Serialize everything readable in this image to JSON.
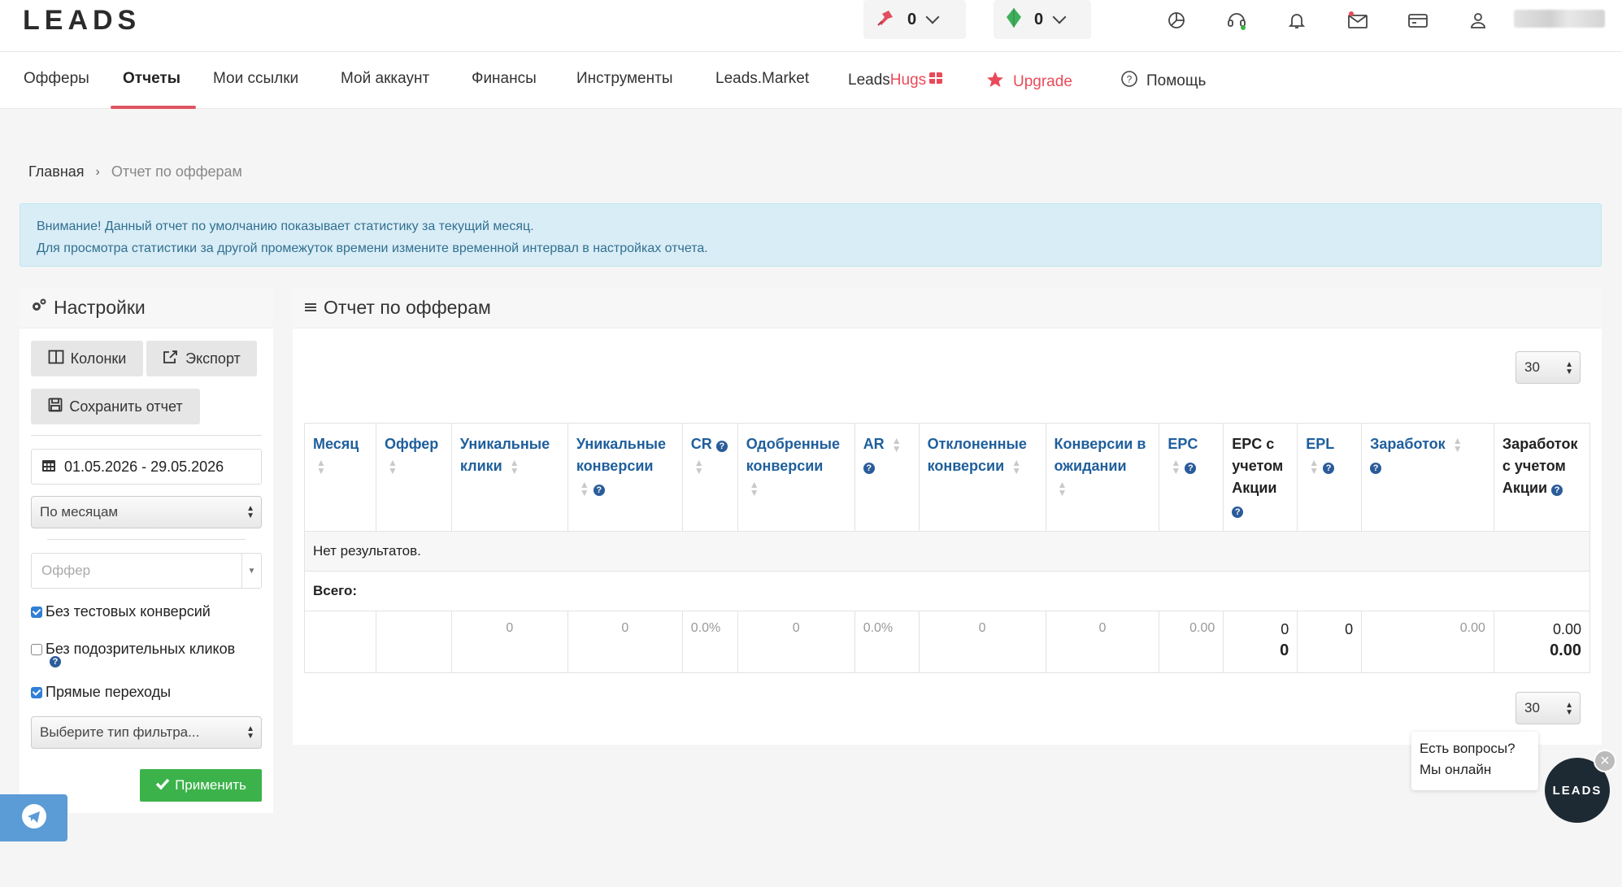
{
  "header": {
    "logo": "LEADS",
    "balance_a": "0",
    "balance_b": "0"
  },
  "nav": {
    "offers": "Офферы",
    "reports": "Отчеты",
    "links": "Мои ссылки",
    "account": "Мой аккаунт",
    "finance": "Финансы",
    "tools": "Инструменты",
    "market": "Leads.Market",
    "hugs_prefix": "Leads",
    "hugs_suffix": "Hugs",
    "upgrade": "Upgrade",
    "help": "Помощь"
  },
  "breadcrumb": {
    "home": "Главная",
    "sep": "›",
    "current": "Отчет по офферам"
  },
  "alert": {
    "line1": "Внимание! Данный отчет по умолчанию показывает статистику за текущий месяц.",
    "line2": "Для просмотра статистики за другой промежуток времени измените временной интервал в настройках отчета."
  },
  "settings": {
    "title": "Настройки",
    "columns_btn": "Колонки",
    "export_btn": "Экспорт",
    "save_btn": "Сохранить отчет",
    "date_range": "01.05.2026 - 29.05.2026",
    "group_by": "По месяцам",
    "offer_placeholder": "Оффер",
    "chk_no_test": "Без тестовых конверсий",
    "chk_no_suspicious": "Без подозрительных кликов",
    "chk_direct": "Прямые переходы",
    "filter_type": "Выберите тип фильтра...",
    "apply_btn": "Применить"
  },
  "report": {
    "title": "Отчет по офферам",
    "per_page": "30",
    "columns": [
      "Месяц",
      "Оффер",
      "Уникальные клики",
      "Уникальные конверсии",
      "CR",
      "Одобренные конверсии",
      "AR",
      "Отклоненные конверсии",
      "Конверсии в ожидании",
      "EPC",
      "EPC с учетом Акции",
      "EPL",
      "Заработок",
      "Заработок с учетом Акции"
    ],
    "no_results": "Нет результатов.",
    "total_label": "Всего:",
    "totals": {
      "unique_clicks": "0",
      "unique_conversions": "0",
      "cr": "0.0%",
      "approved": "0",
      "ar": "0.0%",
      "rejected": "0",
      "pending": "0",
      "epc": "0.00",
      "epc_promo": "0",
      "epc_promo_bold": "0",
      "epl": "0",
      "earnings": "0.00",
      "earnings_promo": "0.00",
      "earnings_promo_bold": "0.00"
    }
  },
  "chat": {
    "line1": "Есть вопросы?",
    "line2": "Мы онлайн",
    "logo": "LEADS"
  },
  "colors": {
    "accent_red": "#e05563",
    "link_blue": "#1f5f9c",
    "apply_green": "#3cb34a",
    "alert_bg": "#d9edf7"
  }
}
